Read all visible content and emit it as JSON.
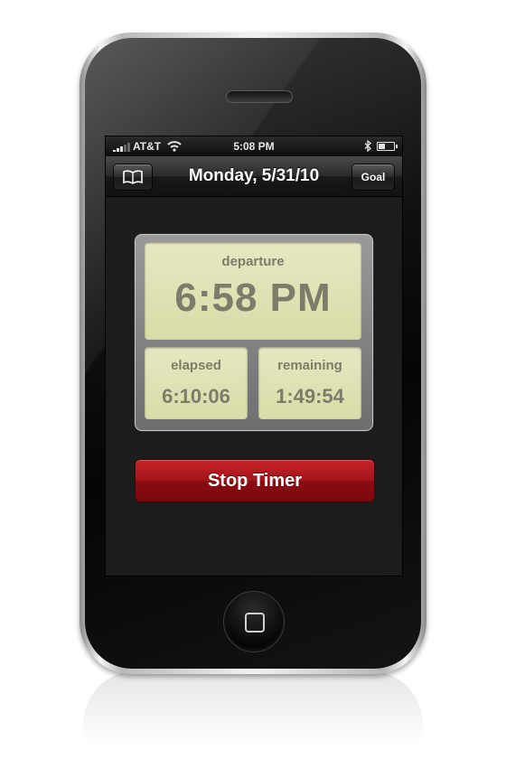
{
  "status_bar": {
    "carrier": "AT&T",
    "time": "5:08 PM",
    "wifi_icon": "wifi-icon",
    "bluetooth_icon": "bluetooth-icon",
    "battery_icon": "battery-icon"
  },
  "nav": {
    "title": "Monday, 5/31/10",
    "left_button_icon": "book-icon",
    "right_button_label": "Goal"
  },
  "timer": {
    "departure_label": "departure",
    "departure_value": "6:58 PM",
    "elapsed_label": "elapsed",
    "elapsed_value": "6:10:06",
    "remaining_label": "remaining",
    "remaining_value": "1:49:54"
  },
  "actions": {
    "stop_label": "Stop Timer",
    "stop_color": "#a31419"
  }
}
